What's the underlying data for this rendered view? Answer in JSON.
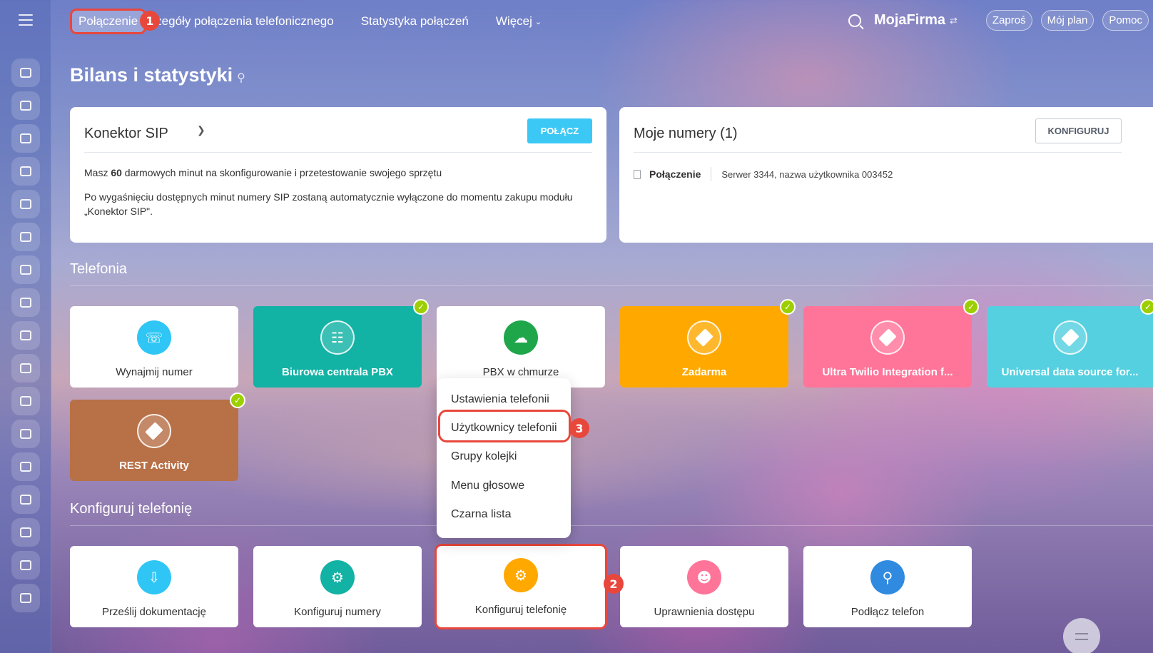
{
  "nav": {
    "tabs": [
      {
        "label": "Połączenie",
        "active": true
      },
      {
        "label": "zczegóły połączenia telefonicznego"
      },
      {
        "label": "Statystyka połączeń"
      },
      {
        "label": "Więcej"
      }
    ]
  },
  "header": {
    "brand": "MojaFirma",
    "invite": "Zaproś",
    "my_plan": "Mój plan",
    "help": "Pomoc"
  },
  "page": {
    "title": "Bilans i statystyki"
  },
  "sip_panel": {
    "title": "Konektor SIP",
    "connect_button": "POŁĄCZ",
    "line1_prefix": "Masz ",
    "line1_minutes": "60",
    "line1_suffix": " darmowych minut na skonfigurowanie i przetestowanie swojego sprzętu",
    "line2": "Po wygaśnięciu dostępnych minut numery SIP zostaną automatycznie wyłączone do momentu zakupu modułu „Konektor SIP\"."
  },
  "numbers_panel": {
    "title": "Moje numery (1)",
    "configure_button": "KONFIGURUJ",
    "row_name": "Połączenie",
    "row_desc": "Serwer 3344, nazwa użytkownika 003452"
  },
  "telephony": {
    "title": "Telefonia",
    "tiles": [
      {
        "label": "Wynajmij numer",
        "color": "#2fc6f6",
        "checked": false
      },
      {
        "label": "Biurowa centrala PBX",
        "color": "#12b2a5",
        "checked": true
      },
      {
        "label": "PBX w chmurze",
        "color": "#1fa64a",
        "checked": false
      },
      {
        "label": "Zadarma",
        "color": "#ffa900",
        "checked": true
      },
      {
        "label": "Ultra Twilio Integration f...",
        "color": "#ff7499",
        "checked": true
      },
      {
        "label": "Universal data source for...",
        "color": "#55d0e0",
        "checked": true
      },
      {
        "label": "REST Activity",
        "color": "#b87047",
        "checked": true
      }
    ]
  },
  "dropdown": {
    "items": [
      "Ustawienia telefonii",
      "Użytkownicy telefonii",
      "Grupy kolejki",
      "Menu głosowe",
      "Czarna lista"
    ]
  },
  "configure": {
    "title": "Konfiguruj telefonię",
    "tiles": [
      {
        "label": "Prześlij dokumentację",
        "color": "#2fc6f6"
      },
      {
        "label": "Konfiguruj numery",
        "color": "#12b2a5"
      },
      {
        "label": "Konfiguruj telefonię",
        "color": "#ffa900"
      },
      {
        "label": "Uprawnienia dostępu",
        "color": "#ff7499"
      },
      {
        "label": "Podłącz telefon",
        "color": "#2f8ae0"
      }
    ]
  },
  "markers": [
    "1",
    "2",
    "3"
  ],
  "colors": {
    "accent": "#3bc8f5",
    "highlight": "#e8473c",
    "check": "#9dcf00"
  }
}
